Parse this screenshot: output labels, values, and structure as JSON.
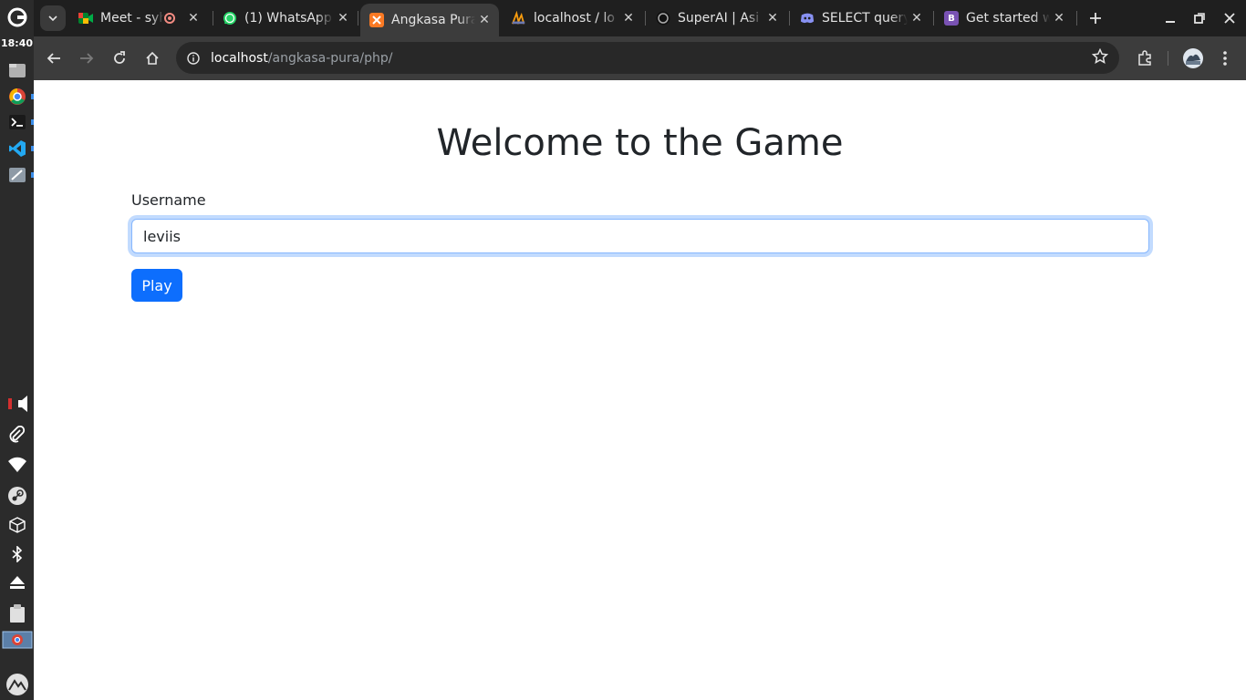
{
  "system": {
    "clock": "18:40"
  },
  "browser": {
    "tabs": [
      {
        "title": "Meet - syh",
        "icon": "google-meet-icon",
        "color": "#34a853"
      },
      {
        "title": "(1) WhatsApp",
        "icon": "whatsapp-icon",
        "color": "#25d366"
      },
      {
        "title": "Angkasa Pura",
        "icon": "xampp-icon",
        "color": "#fb7a24"
      },
      {
        "title": "localhost / lo",
        "icon": "phpmyadmin-icon",
        "color": "#f89c0e"
      },
      {
        "title": "SuperAI | Asi",
        "icon": "superai-icon",
        "color": "#111111"
      },
      {
        "title": "SELECT query",
        "icon": "discord-icon",
        "color": "#8891f2"
      },
      {
        "title": "Get started w",
        "icon": "bootstrap-icon",
        "color": "#7952b3"
      }
    ],
    "active_tab": 2,
    "bootstrap_letter": "B",
    "url_host": "localhost",
    "url_path": "/angkasa-pura/php/"
  },
  "page": {
    "title": "Welcome to the Game",
    "username_label": "Username",
    "username_value": "leviis",
    "play_label": "Play"
  },
  "colors": {
    "primary": "#0d6efd",
    "focus_border": "#86b7fe",
    "text": "#212529"
  }
}
